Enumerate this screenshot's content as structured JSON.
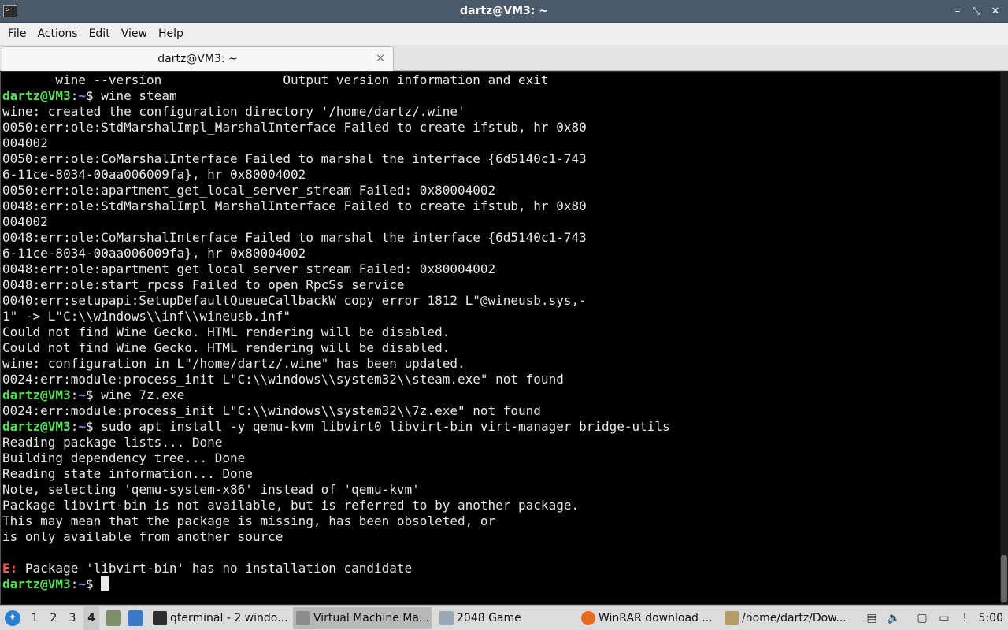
{
  "window": {
    "title": "dartz@VM3: ~",
    "buttons": {
      "minimize": "–",
      "maximize": "⤡",
      "close": "✕"
    }
  },
  "menu": [
    "File",
    "Actions",
    "Edit",
    "View",
    "Help"
  ],
  "tab": {
    "label": "dartz@VM3: ~",
    "close": "×"
  },
  "prompt": {
    "user": "dartz@VM3",
    "path": "~"
  },
  "terminal_lines": [
    {
      "type": "out",
      "text": "       wine --version                Output version information and exit"
    },
    {
      "type": "cmd",
      "text": "wine steam"
    },
    {
      "type": "out",
      "text": "wine: created the configuration directory '/home/dartz/.wine'"
    },
    {
      "type": "out",
      "text": "0050:err:ole:StdMarshalImpl_MarshalInterface Failed to create ifstub, hr 0x80"
    },
    {
      "type": "out",
      "text": "004002"
    },
    {
      "type": "out",
      "text": "0050:err:ole:CoMarshalInterface Failed to marshal the interface {6d5140c1-743"
    },
    {
      "type": "out",
      "text": "6-11ce-8034-00aa006009fa}, hr 0x80004002"
    },
    {
      "type": "out",
      "text": "0050:err:ole:apartment_get_local_server_stream Failed: 0x80004002"
    },
    {
      "type": "out",
      "text": "0048:err:ole:StdMarshalImpl_MarshalInterface Failed to create ifstub, hr 0x80"
    },
    {
      "type": "out",
      "text": "004002"
    },
    {
      "type": "out",
      "text": "0048:err:ole:CoMarshalInterface Failed to marshal the interface {6d5140c1-743"
    },
    {
      "type": "out",
      "text": "6-11ce-8034-00aa006009fa}, hr 0x80004002"
    },
    {
      "type": "out",
      "text": "0048:err:ole:apartment_get_local_server_stream Failed: 0x80004002"
    },
    {
      "type": "out",
      "text": "0048:err:ole:start_rpcss Failed to open RpcSs service"
    },
    {
      "type": "out",
      "text": "0040:err:setupapi:SetupDefaultQueueCallbackW copy error 1812 L\"@wineusb.sys,-"
    },
    {
      "type": "out",
      "text": "1\" -> L\"C:\\\\windows\\\\inf\\\\wineusb.inf\""
    },
    {
      "type": "out",
      "text": "Could not find Wine Gecko. HTML rendering will be disabled."
    },
    {
      "type": "out",
      "text": "Could not find Wine Gecko. HTML rendering will be disabled."
    },
    {
      "type": "out",
      "text": "wine: configuration in L\"/home/dartz/.wine\" has been updated."
    },
    {
      "type": "out",
      "text": "0024:err:module:process_init L\"C:\\\\windows\\\\system32\\\\steam.exe\" not found"
    },
    {
      "type": "cmd",
      "text": "wine 7z.exe"
    },
    {
      "type": "out",
      "text": "0024:err:module:process_init L\"C:\\\\windows\\\\system32\\\\7z.exe\" not found"
    },
    {
      "type": "cmd",
      "text": "sudo apt install -y qemu-kvm libvirt0 libvirt-bin virt-manager bridge-utils"
    },
    {
      "type": "out",
      "text": "Reading package lists... Done"
    },
    {
      "type": "out",
      "text": "Building dependency tree... Done"
    },
    {
      "type": "out",
      "text": "Reading state information... Done"
    },
    {
      "type": "out",
      "text": "Note, selecting 'qemu-system-x86' instead of 'qemu-kvm'"
    },
    {
      "type": "out",
      "text": "Package libvirt-bin is not available, but is referred to by another package."
    },
    {
      "type": "out",
      "text": "This may mean that the package is missing, has been obsoleted, or"
    },
    {
      "type": "out",
      "text": "is only available from another source"
    },
    {
      "type": "out",
      "text": ""
    },
    {
      "type": "err",
      "prefix": "E:",
      "text": " Package 'libvirt-bin' has no installation candidate"
    },
    {
      "type": "cmd",
      "text": "",
      "cursor": true
    }
  ],
  "taskbar": {
    "workspaces": [
      "1",
      "2",
      "3",
      "4"
    ],
    "active_workspace": "4",
    "tasks": [
      {
        "label": "qterminal - 2 windo...",
        "icon": "terminal-icon",
        "active": false
      },
      {
        "label": "Virtual Machine Ma...",
        "icon": "virt-manager-icon",
        "active": true
      },
      {
        "label": "2048 Game",
        "icon": "window-icon",
        "active": false
      },
      {
        "label": "WinRAR download ...",
        "icon": "firefox-icon",
        "active": false
      },
      {
        "label": "/home/dartz/Dow...",
        "icon": "archive-icon",
        "active": false
      }
    ],
    "clock": "5:00"
  },
  "colors": {
    "prompt_user": "#54e254",
    "prompt_path": "#6f8dff",
    "error": "#ff5555",
    "terminal_bg": "#000000"
  }
}
